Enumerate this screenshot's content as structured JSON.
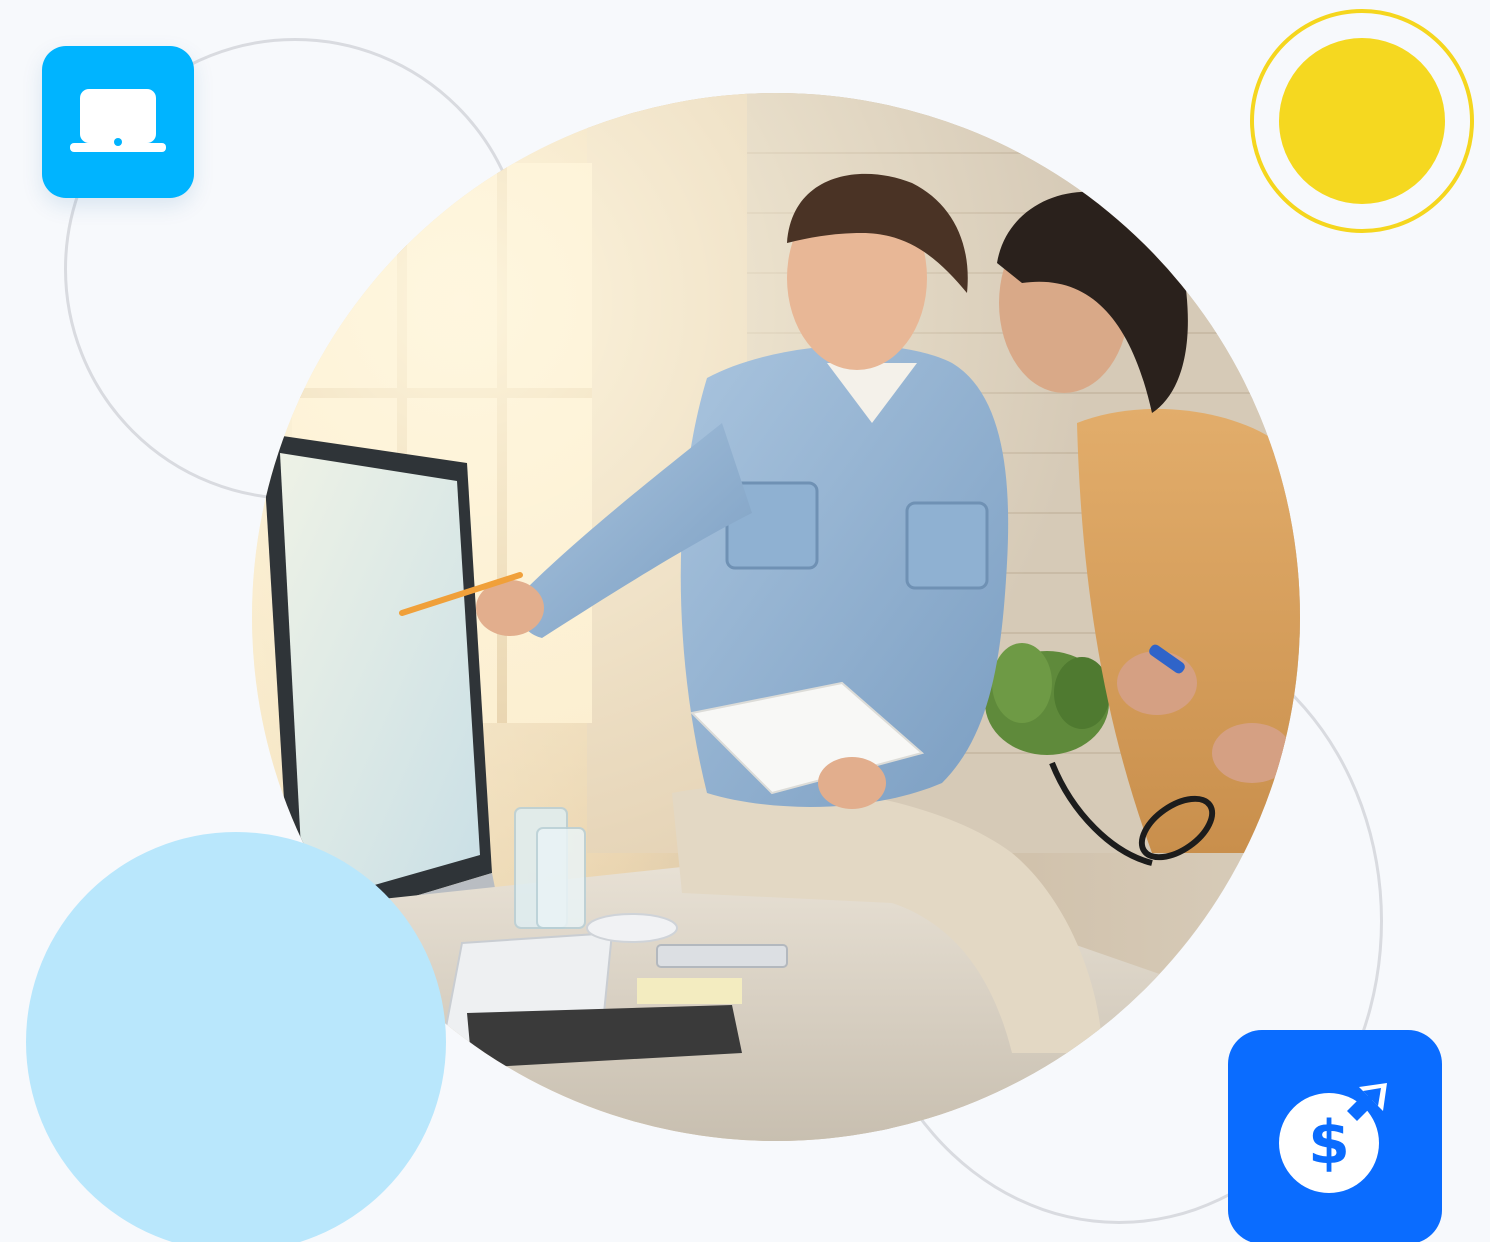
{
  "scene": {
    "description_free": true
  },
  "icons": {
    "laptop": "laptop-icon",
    "money_growth": "money-growth-icon"
  },
  "colors": {
    "background": "#f7f9fc",
    "ring_outline": "#d9dbe0",
    "light_blue_blob": "#b9e7fc",
    "sun_yellow": "#f5d820",
    "laptop_tile": "#00b4ff",
    "money_tile": "#0a6cff"
  }
}
